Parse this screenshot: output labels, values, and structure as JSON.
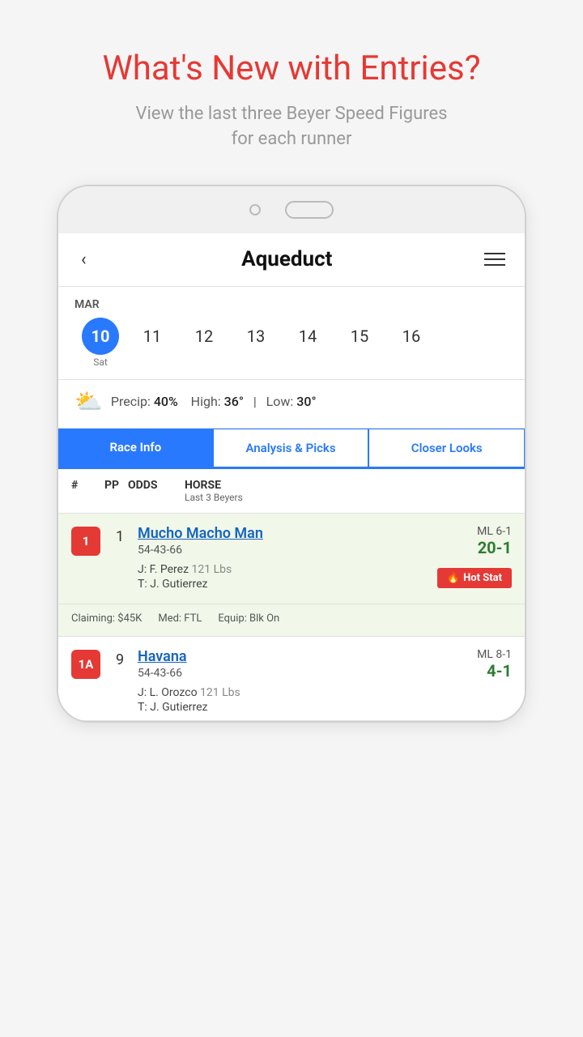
{
  "page": {
    "title": "What's New with Entries?",
    "subtitle": "View the last three Beyer Speed Figures\nfor each runner"
  },
  "app": {
    "venue": "Aqueduct",
    "back_label": "‹",
    "menu_icon": "hamburger"
  },
  "calendar": {
    "month": "MAR",
    "days": [
      {
        "num": "10",
        "day": "Sat",
        "active": true
      },
      {
        "num": "11",
        "day": "",
        "active": false
      },
      {
        "num": "12",
        "day": "",
        "active": false
      },
      {
        "num": "13",
        "day": "",
        "active": false
      },
      {
        "num": "14",
        "day": "",
        "active": false
      },
      {
        "num": "15",
        "day": "",
        "active": false
      },
      {
        "num": "16",
        "day": "",
        "active": false
      }
    ]
  },
  "weather": {
    "icon": "⛅",
    "precip_label": "Precip:",
    "precip_val": "40%",
    "high_label": "High:",
    "high_val": "36°",
    "low_label": "Low:",
    "low_val": "30°",
    "separator": "|"
  },
  "tabs": [
    {
      "label": "Race Info",
      "active": true
    },
    {
      "label": "Analysis & Picks",
      "active": false
    },
    {
      "label": "Closer Looks",
      "active": false
    }
  ],
  "table_header": {
    "col1": "#",
    "col2": "PP",
    "col3": "ODDS",
    "col4": "HORSE",
    "col4_sub": "Last 3 Beyers"
  },
  "entries": [
    {
      "badge": "1",
      "pp": "1",
      "ml": "ML 6-1",
      "odds": "20-1",
      "name": "Mucho Macho Man",
      "beyers": "54-43-66",
      "jockey": "J: F. Perez",
      "jockey_wt": "121 Lbs",
      "trainer": "T: J. Gutierrez",
      "hot_stat": true,
      "hot_stat_label": "🔥 Hot Stat",
      "claiming": "Claiming: $45K",
      "med": "Med: FTL",
      "equip": "Equip: Blk On",
      "green_bg": true
    },
    {
      "badge": "1A",
      "pp": "9",
      "ml": "ML 8-1",
      "odds": "4-1",
      "name": "Havana",
      "beyers": "54-43-66",
      "jockey": "J: L. Orozco",
      "jockey_wt": "121 Lbs",
      "trainer": "T: J. Gutierrez",
      "hot_stat": false,
      "green_bg": false
    }
  ]
}
